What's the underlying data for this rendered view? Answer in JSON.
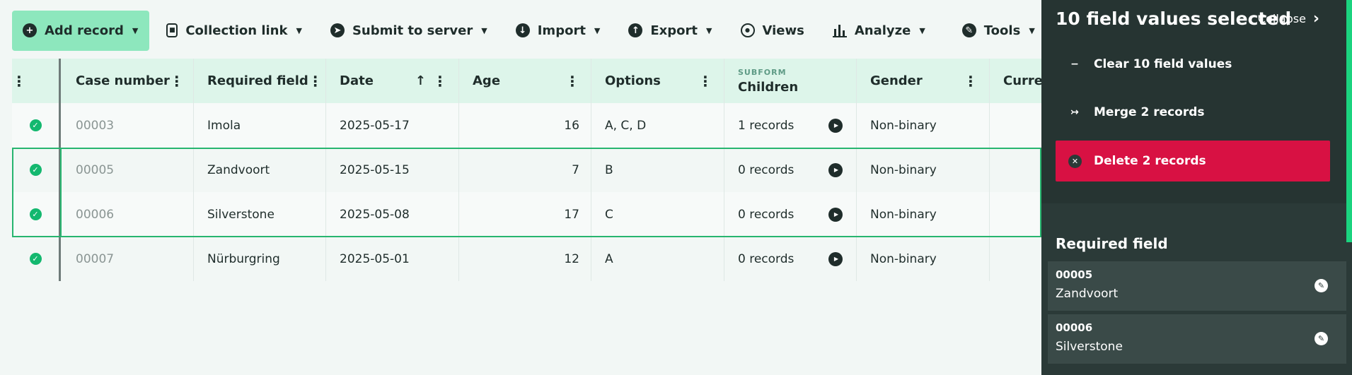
{
  "toolbar": {
    "add_record": "Add record",
    "collection_link": "Collection link",
    "submit_to_server": "Submit to server",
    "import": "Import",
    "export": "Export",
    "views": "Views",
    "analyze": "Analyze",
    "tools": "Tools"
  },
  "table": {
    "headers": {
      "case_number": "Case number",
      "required_field": "Required field",
      "date": "Date",
      "age": "Age",
      "options": "Options",
      "children_subform_tag": "SUBFORM",
      "children": "Children",
      "gender": "Gender",
      "current": "Curre"
    },
    "rows": [
      {
        "case": "00003",
        "required": "Imola",
        "date": "2025-05-17",
        "age": "16",
        "options": "A, C, D",
        "children": "1 records",
        "gender": "Non-binary"
      },
      {
        "case": "00005",
        "required": "Zandvoort",
        "date": "2025-05-15",
        "age": "7",
        "options": "B",
        "children": "0 records",
        "gender": "Non-binary"
      },
      {
        "case": "00006",
        "required": "Silverstone",
        "date": "2025-05-08",
        "age": "17",
        "options": "C",
        "children": "0 records",
        "gender": "Non-binary"
      },
      {
        "case": "00007",
        "required": "Nürburgring",
        "date": "2025-05-01",
        "age": "12",
        "options": "A",
        "children": "0 records",
        "gender": "Non-binary"
      }
    ]
  },
  "panel": {
    "title": "10 field values selected",
    "collapse": "Collapse",
    "actions": {
      "clear": "Clear 10 field values",
      "merge": "Merge 2 records",
      "delete": "Delete 2 records"
    },
    "section_title": "Required field",
    "records": [
      {
        "id": "00005",
        "name": "Zandvoort"
      },
      {
        "id": "00006",
        "name": "Silverstone"
      }
    ]
  },
  "colors": {
    "accent": "#8de7bd",
    "danger": "#d81143",
    "panel_bg": "#2b3a38",
    "check": "#14b86f"
  }
}
